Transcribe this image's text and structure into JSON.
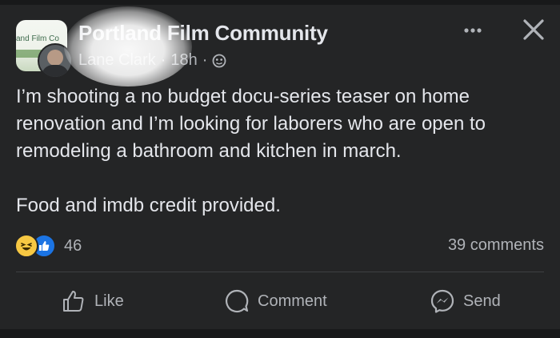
{
  "post": {
    "group_name": "Portland Film Community",
    "group_avatar_text": "and Film Co",
    "author": "Lane Clark",
    "time": "18h",
    "separator": "·",
    "privacy_icon": "globe-icon",
    "body_line_1": "I’m shooting a no budget docu-series teaser on home renovation and I’m looking for laborers who are open to remodeling a bathroom and kitchen in march.",
    "body_line_2": "Food and imdb credit provided.",
    "reaction_count": "46",
    "reaction_icons": [
      "haha-icon",
      "like-icon"
    ],
    "comments": "39 comments"
  },
  "header": {
    "more_icon": "more-horizontal-icon",
    "close_icon": "close-icon"
  },
  "actions": {
    "like_label": "Like",
    "comment_label": "Comment",
    "send_label": "Send"
  },
  "colors": {
    "background": "#242526",
    "text": "#e4e6eb",
    "secondary": "#b0b3b8",
    "like_blue": "#1b74e4",
    "haha_yellow": "#f7c843"
  }
}
